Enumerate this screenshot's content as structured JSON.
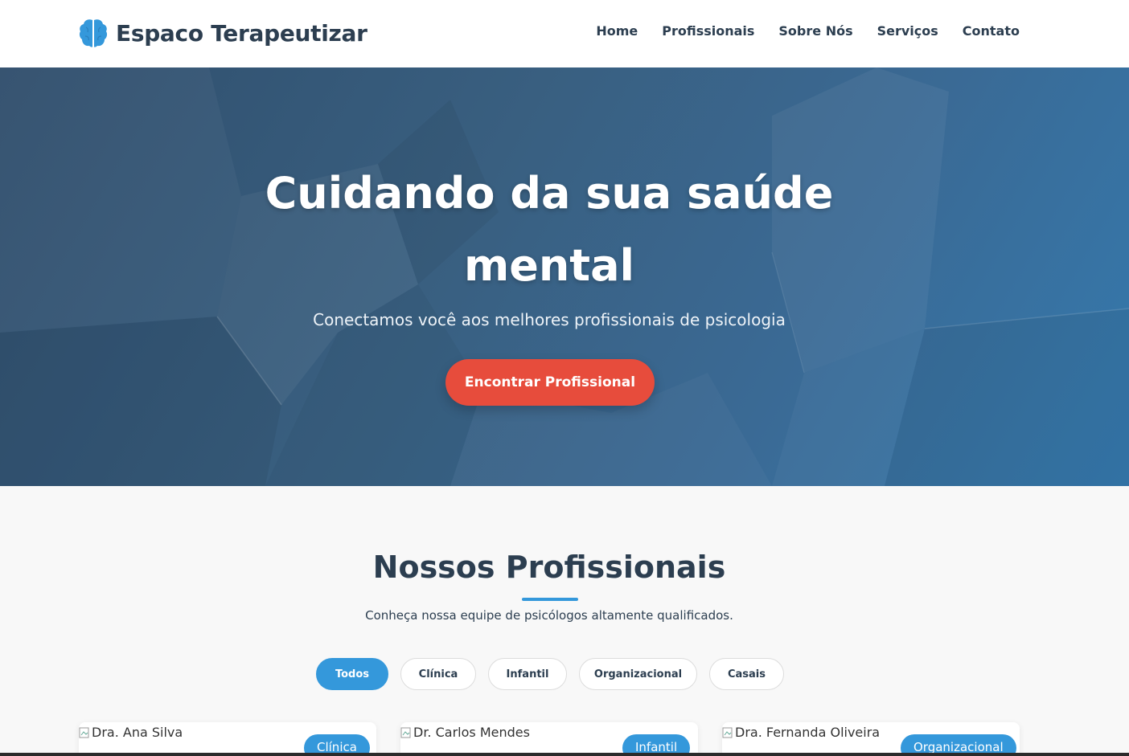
{
  "brand": {
    "name": "Espaco Terapeutizar",
    "icon": "brain-icon",
    "icon_color": "#3498db"
  },
  "nav": {
    "items": [
      "Home",
      "Profissionais",
      "Sobre Nós",
      "Serviços",
      "Contato"
    ]
  },
  "hero": {
    "title_line1": "Cuidando da sua saúde",
    "title_line2": "mental",
    "subtitle": "Conectamos você aos melhores profissionais de psicologia",
    "cta_label": "Encontrar Profissional",
    "cta_color": "#e74c3c"
  },
  "professionals": {
    "title": "Nossos Profissionais",
    "subtitle": "Conheça nossa equipe de psicólogos altamente qualificados.",
    "filters": [
      "Todos",
      "Clínica",
      "Infantil",
      "Organizacional",
      "Casais"
    ],
    "active_filter": "Todos",
    "cards": [
      {
        "image_alt": "Dra. Ana Silva",
        "badge": "Clínica"
      },
      {
        "image_alt": "Dr. Carlos Mendes",
        "badge": "Infantil"
      },
      {
        "image_alt": "Dra. Fernanda Oliveira",
        "badge": "Organizacional"
      }
    ]
  },
  "colors": {
    "accent": "#3498db",
    "text": "#2c3e50",
    "cta": "#e74c3c"
  }
}
